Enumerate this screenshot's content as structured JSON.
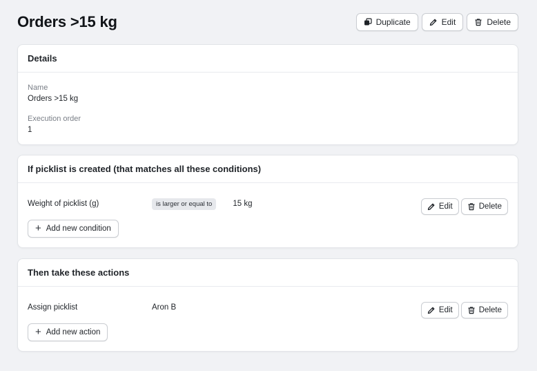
{
  "page": {
    "title": "Orders >15 kg"
  },
  "toolbar": {
    "duplicate_label": "Duplicate",
    "edit_label": "Edit",
    "delete_label": "Delete"
  },
  "details": {
    "title": "Details",
    "name_label": "Name",
    "name_value": "Orders >15 kg",
    "order_label": "Execution order",
    "order_value": "1"
  },
  "conditions": {
    "title": "If picklist is created (that matches all these conditions)",
    "items": [
      {
        "field": "Weight of picklist (g)",
        "operator": "is larger or equal to",
        "value": "15 kg",
        "edit_label": "Edit",
        "delete_label": "Delete"
      }
    ],
    "add_label": "Add new condition"
  },
  "actions": {
    "title": "Then take these actions",
    "items": [
      {
        "action": "Assign picklist",
        "value": "Aron B",
        "edit_label": "Edit",
        "delete_label": "Delete"
      }
    ],
    "add_label": "Add new action"
  },
  "icons": {
    "duplicate": "duplicate-icon",
    "edit": "pencil-icon",
    "delete": "trash-icon",
    "add": "plus-icon"
  }
}
